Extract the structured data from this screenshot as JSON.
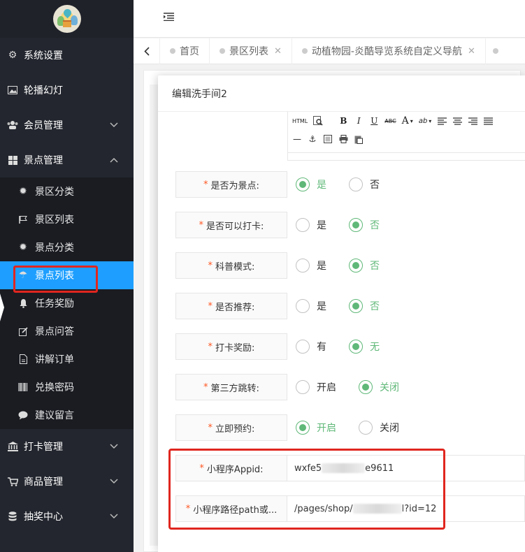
{
  "sidebar": {
    "menu": [
      {
        "label": "系统设置",
        "icon": "gears-icon"
      },
      {
        "label": "轮播幻灯",
        "icon": "image-icon"
      },
      {
        "label": "会员管理",
        "icon": "users-icon"
      },
      {
        "label": "景点管理",
        "icon": "grid-icon"
      }
    ],
    "submenu": [
      {
        "label": "景区分类",
        "icon": "gear-icon"
      },
      {
        "label": "景区列表",
        "icon": "flag-icon"
      },
      {
        "label": "景点分类",
        "icon": "gear-icon"
      },
      {
        "label": "景点列表",
        "icon": "umbrella-icon",
        "active": true
      },
      {
        "label": "任务奖励",
        "icon": "bell-icon"
      },
      {
        "label": "景点问答",
        "icon": "edit-icon"
      },
      {
        "label": "讲解订单",
        "icon": "document-icon"
      },
      {
        "label": "兑换密码",
        "icon": "barcode-icon"
      },
      {
        "label": "建议留言",
        "icon": "message-icon"
      }
    ],
    "menu_bottom": [
      {
        "label": "打卡管理",
        "icon": "bank-icon"
      },
      {
        "label": "商品管理",
        "icon": "cart-icon"
      },
      {
        "label": "抽奖中心",
        "icon": "database-icon"
      }
    ]
  },
  "tabs": [
    {
      "label": "首页"
    },
    {
      "label": "景区列表"
    },
    {
      "label": "动植物园-炎酷导览系统自定义导航"
    }
  ],
  "modal": {
    "title": "编辑洗手间2",
    "toolbar": {
      "html": "HTML",
      "bold": "B",
      "italic": "I",
      "underline": "U",
      "strike": "ABC",
      "font": "A",
      "hr": "—"
    },
    "fields": [
      {
        "label": "是否为景点:",
        "options": [
          "是",
          "否"
        ],
        "selected": 0
      },
      {
        "label": "是否可以打卡:",
        "options": [
          "是",
          "否"
        ],
        "selected": 1
      },
      {
        "label": "科普模式:",
        "options": [
          "是",
          "否"
        ],
        "selected": 1
      },
      {
        "label": "是否推荐:",
        "options": [
          "是",
          "否"
        ],
        "selected": 1
      },
      {
        "label": "打卡奖励:",
        "options": [
          "有",
          "无"
        ],
        "selected": 1
      },
      {
        "label": "第三方跳转:",
        "options": [
          "开启",
          "关闭"
        ],
        "selected": 1
      },
      {
        "label": "立即预约:",
        "options": [
          "开启",
          "关闭"
        ],
        "selected": 0
      }
    ],
    "appid": {
      "label": "小程序Appid:",
      "value_start": "wxfe5",
      "value_end": "e9611"
    },
    "path": {
      "label": "小程序路径path或...",
      "value_start": "/pages/shop/",
      "value_end": "l?id=12"
    },
    "required_mark": "*"
  },
  "colors": {
    "sidebar": "#23262e",
    "active": "#1e9fff",
    "radio_on": "#5fb878",
    "highlight": "#e0261f"
  }
}
